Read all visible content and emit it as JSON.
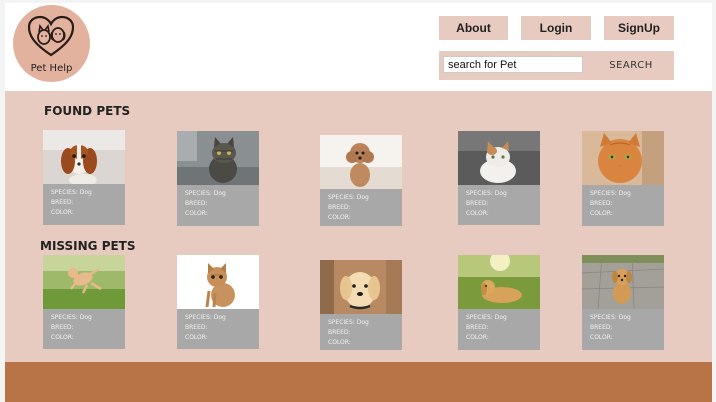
{
  "header": {
    "logo_text": "Pet Help",
    "nav": {
      "about": "About",
      "login": "Login",
      "signup": "SignUp"
    },
    "search": {
      "value": "search for Pet",
      "button": "SEARCH"
    }
  },
  "found": {
    "title": "FOUND PETS",
    "cards": [
      {
        "species": "SPECIES: Dog",
        "breed": "BREED:",
        "color": "COLOR:"
      },
      {
        "species": "SPECIES: Dog",
        "breed": "BREED:",
        "color": "COLOR:"
      },
      {
        "species": "SPECIES: Dog",
        "breed": "BREED:",
        "color": "COLOR:"
      },
      {
        "species": "SPECIES: Dog",
        "breed": "BREED:",
        "color": "COLOR:"
      },
      {
        "species": "SPECIES: Dog",
        "breed": "BREED:",
        "color": "COLOR:"
      }
    ]
  },
  "missing": {
    "title": "MISSING PETS",
    "cards": [
      {
        "species": "SPECIES: Dog",
        "breed": "BREED:",
        "color": "COLOR:"
      },
      {
        "species": "SPECIES: Dog",
        "breed": "BREED:",
        "color": "COLOR:"
      },
      {
        "species": "SPECIES: Dog",
        "breed": "BREED:",
        "color": "COLOR:"
      },
      {
        "species": "SPECIES: Dog",
        "breed": "BREED:",
        "color": "COLOR:"
      },
      {
        "species": "SPECIES: Dog",
        "breed": "BREED:",
        "color": "COLOR:"
      }
    ]
  },
  "colors": {
    "page_bg": "#e8cbc0",
    "logo_bg": "#e3b29f",
    "card_bg": "#a8a8a8",
    "footer_bg": "#b87346"
  },
  "photos": {
    "found": [
      "spaniel-puppy-photo",
      "tabby-cat-photo",
      "poodle-puppy-photo",
      "white-cat-photo",
      "orange-cat-photo"
    ],
    "missing": [
      "jumping-kitten-photo",
      "kitten-photo",
      "golden-puppy-photo",
      "golden-retriever-photo",
      "golden-puppy-pavement-photo"
    ]
  }
}
